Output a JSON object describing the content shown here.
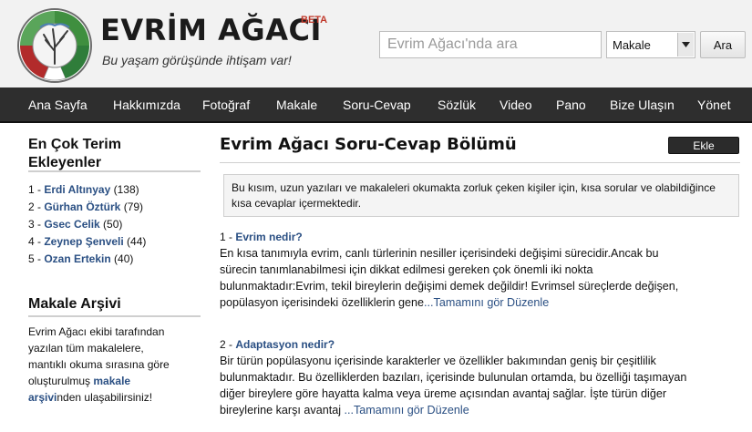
{
  "header": {
    "brand": "EVRİM AĞACI",
    "beta": "BETA",
    "slogan": "Bu yaşam görüşünde ihtişam var!",
    "search_placeholder": "Evrim Ağacı'nda ara",
    "search_scope": "Makale",
    "search_button": "Ara"
  },
  "nav": {
    "items": [
      "Ana Sayfa",
      "Hakkımızda",
      "Fotoğraf",
      "Makale",
      "Soru-Cevap",
      "Sözlük",
      "Video",
      "Pano",
      "Bize Ulaşın",
      "Yönet"
    ]
  },
  "sidebar": {
    "top_terms": {
      "title_line1": "En Çok Terim",
      "title_line2": "Ekleyenler",
      "entries": [
        {
          "rank": "1 - ",
          "name": "Erdi Altınyay",
          "count": " (138)"
        },
        {
          "rank": "2 - ",
          "name": "Gürhan Öztürk",
          "count": " (79)"
        },
        {
          "rank": "3 - ",
          "name": "Gsec Celik",
          "count": " (50)"
        },
        {
          "rank": "4 - ",
          "name": "Zeynep Şenveli",
          "count": " (44)"
        },
        {
          "rank": "5 - ",
          "name": "Ozan Ertekin",
          "count": " (40)"
        }
      ]
    },
    "archive": {
      "title": "Makale Arşivi",
      "text_before": "Evrim Ağacı ekibi tarafından yazılan tüm makalelere, mantıklı okuma sırasına göre oluşturulmuş ",
      "link": "makale arşivi",
      "text_after": "nden ulaşabilirsiniz!"
    }
  },
  "main": {
    "title": "Evrim Ağacı Soru-Cevap Bölümü",
    "add_button": "Ekle",
    "intro": "Bu kısım, uzun yazıları ve makaleleri okumakta zorluk çeken kişiler için, kısa sorular ve olabildiğince kısa cevaplar içermektedir.",
    "questions": [
      {
        "number": "1 - ",
        "title": "Evrim nedir?",
        "lines": [
          "En kısa tanımıyla evrim, canlı türlerinin nesiller içerisindeki değişimi sürecidir.Ancak bu",
          "sürecin tanımlanabilmesi için dikkat edilmesi gereken çok önemli iki nokta",
          "bulunmaktadır:Evrim, tekil bireylerin değişimi demek değildir! Evrimsel süreçlerde değişen,",
          "popülasyon içerisindeki özelliklerin gene"
        ],
        "more": "...Tamamını gör",
        "edit": "Düzenle"
      },
      {
        "number": "2 - ",
        "title": "Adaptasyon nedir?",
        "lines": [
          "Bir türün popülasyonu içerisinde karakterler ve özellikler bakımından geniş bir çeşitlilik",
          "bulunmaktadır. Bu özelliklerden bazıları, içerisinde bulunulan ortamda, bu özelliği taşımayan",
          "diğer bireylere göre hayatta kalma veya üreme açısından avantaj sağlar. İşte türün diğer",
          "bireylerine karşı avantaj"
        ],
        "more": "...Tamamını gör",
        "edit": "Düzenle"
      }
    ]
  }
}
